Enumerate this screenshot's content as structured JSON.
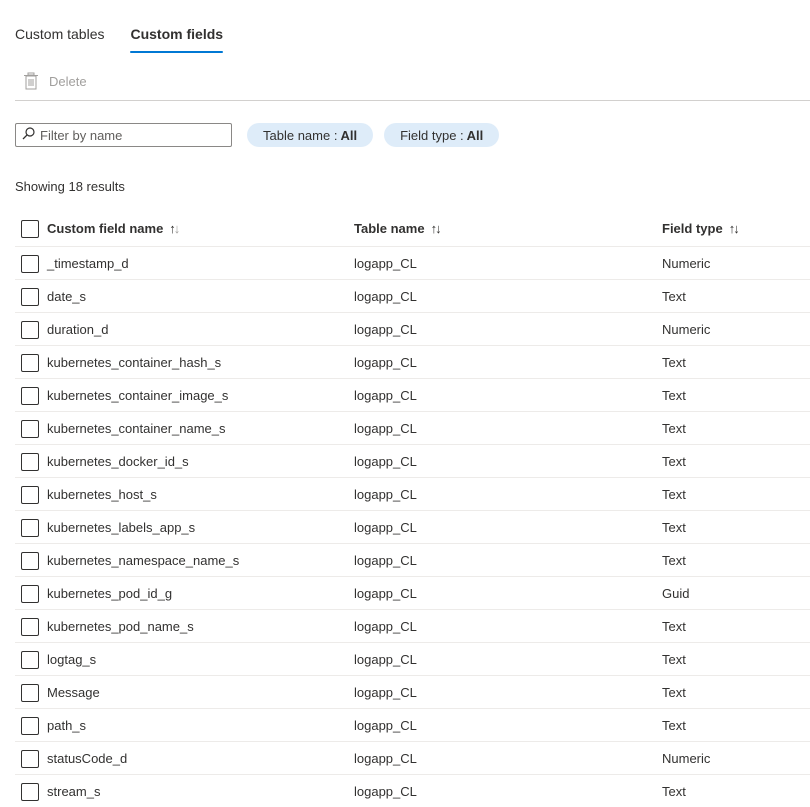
{
  "tabs": [
    {
      "label": "Custom tables",
      "active": false
    },
    {
      "label": "Custom fields",
      "active": true
    }
  ],
  "toolbar": {
    "delete_label": "Delete"
  },
  "filter": {
    "placeholder": "Filter by name",
    "value": ""
  },
  "pills": {
    "table_name": {
      "label": "Table name :",
      "value": "All"
    },
    "field_type": {
      "label": "Field type :",
      "value": "All"
    }
  },
  "results_text": "Showing 18 results",
  "columns": {
    "name": "Custom field name",
    "table": "Table name",
    "type": "Field type",
    "sort_up": "↑",
    "sort_down": "↓"
  },
  "rows": [
    {
      "name": "_timestamp_d",
      "table": "logapp_CL",
      "type": "Numeric"
    },
    {
      "name": "date_s",
      "table": "logapp_CL",
      "type": "Text"
    },
    {
      "name": "duration_d",
      "table": "logapp_CL",
      "type": "Numeric"
    },
    {
      "name": "kubernetes_container_hash_s",
      "table": "logapp_CL",
      "type": "Text"
    },
    {
      "name": "kubernetes_container_image_s",
      "table": "logapp_CL",
      "type": "Text"
    },
    {
      "name": "kubernetes_container_name_s",
      "table": "logapp_CL",
      "type": "Text"
    },
    {
      "name": "kubernetes_docker_id_s",
      "table": "logapp_CL",
      "type": "Text"
    },
    {
      "name": "kubernetes_host_s",
      "table": "logapp_CL",
      "type": "Text"
    },
    {
      "name": "kubernetes_labels_app_s",
      "table": "logapp_CL",
      "type": "Text"
    },
    {
      "name": "kubernetes_namespace_name_s",
      "table": "logapp_CL",
      "type": "Text"
    },
    {
      "name": "kubernetes_pod_id_g",
      "table": "logapp_CL",
      "type": "Guid"
    },
    {
      "name": "kubernetes_pod_name_s",
      "table": "logapp_CL",
      "type": "Text"
    },
    {
      "name": "logtag_s",
      "table": "logapp_CL",
      "type": "Text"
    },
    {
      "name": "Message",
      "table": "logapp_CL",
      "type": "Text"
    },
    {
      "name": "path_s",
      "table": "logapp_CL",
      "type": "Text"
    },
    {
      "name": "statusCode_d",
      "table": "logapp_CL",
      "type": "Numeric"
    },
    {
      "name": "stream_s",
      "table": "logapp_CL",
      "type": "Text"
    }
  ],
  "colors": {
    "accent": "#0078d4",
    "pill_bg": "#deecf9",
    "disabled": "#a19f9d"
  },
  "icons": {
    "delete": "trash-icon",
    "filter": "search-icon"
  }
}
